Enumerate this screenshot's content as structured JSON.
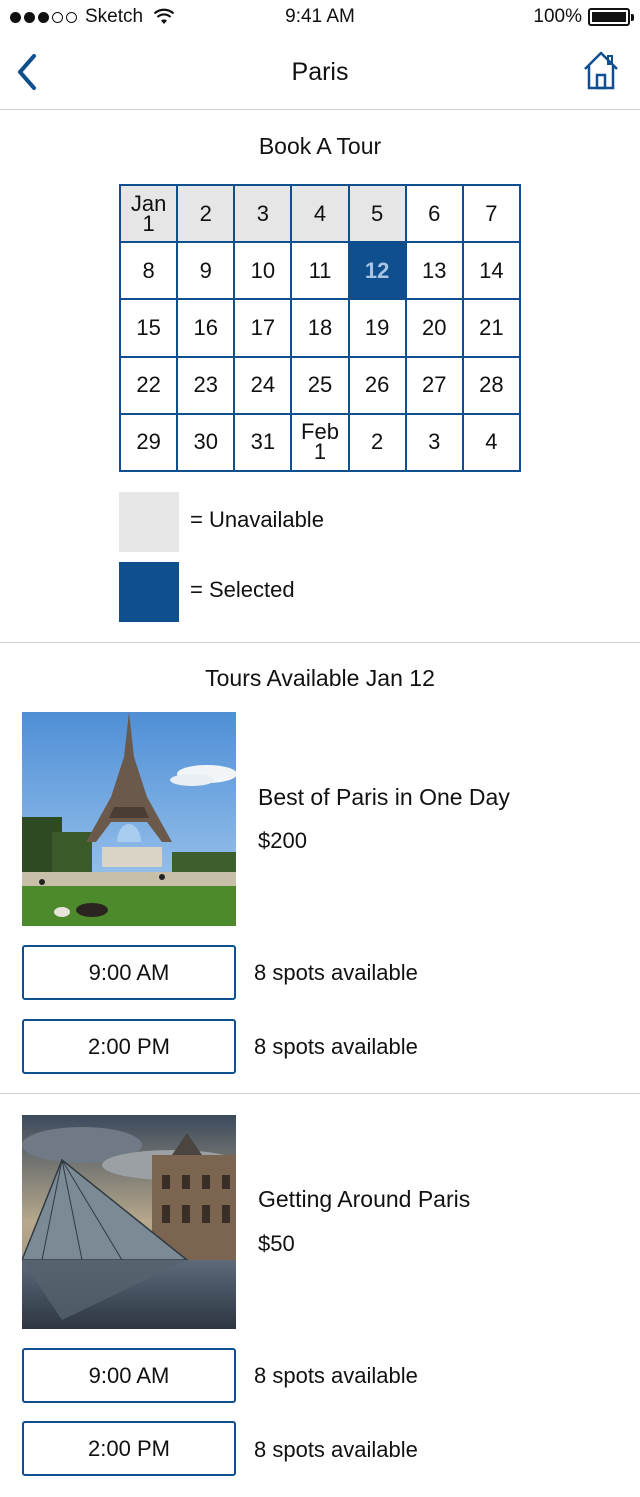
{
  "status_bar": {
    "carrier": "Sketch",
    "time": "9:41 AM",
    "battery": "100%"
  },
  "nav": {
    "title": "Paris",
    "back_icon": "chevron-left-icon",
    "home_icon": "home-icon"
  },
  "calendar": {
    "title": "Book A Tour",
    "rows": [
      [
        {
          "label": "Jan\n1",
          "state": "unavailable"
        },
        {
          "label": "2",
          "state": "unavailable"
        },
        {
          "label": "3",
          "state": "unavailable"
        },
        {
          "label": "4",
          "state": "unavailable"
        },
        {
          "label": "5",
          "state": "unavailable"
        },
        {
          "label": "6",
          "state": "available"
        },
        {
          "label": "7",
          "state": "available"
        }
      ],
      [
        {
          "label": "8",
          "state": "available"
        },
        {
          "label": "9",
          "state": "available"
        },
        {
          "label": "10",
          "state": "available"
        },
        {
          "label": "11",
          "state": "available"
        },
        {
          "label": "12",
          "state": "selected"
        },
        {
          "label": "13",
          "state": "available"
        },
        {
          "label": "14",
          "state": "available"
        }
      ],
      [
        {
          "label": "15",
          "state": "available"
        },
        {
          "label": "16",
          "state": "available"
        },
        {
          "label": "17",
          "state": "available"
        },
        {
          "label": "18",
          "state": "available"
        },
        {
          "label": "19",
          "state": "available"
        },
        {
          "label": "20",
          "state": "available"
        },
        {
          "label": "21",
          "state": "available"
        }
      ],
      [
        {
          "label": "22",
          "state": "available"
        },
        {
          "label": "23",
          "state": "available"
        },
        {
          "label": "24",
          "state": "available"
        },
        {
          "label": "25",
          "state": "available"
        },
        {
          "label": "26",
          "state": "available"
        },
        {
          "label": "27",
          "state": "available"
        },
        {
          "label": "28",
          "state": "available"
        }
      ],
      [
        {
          "label": "29",
          "state": "available"
        },
        {
          "label": "30",
          "state": "available"
        },
        {
          "label": "31",
          "state": "available"
        },
        {
          "label": "Feb\n1",
          "state": "available"
        },
        {
          "label": "2",
          "state": "available"
        },
        {
          "label": "3",
          "state": "available"
        },
        {
          "label": "4",
          "state": "available"
        }
      ]
    ]
  },
  "legend": {
    "unavailable_label": "= Unavailable",
    "selected_label": "= Selected"
  },
  "colors": {
    "brand_blue": "#0f4f8e",
    "unavailable_gray": "#e6e6e6",
    "divider": "#cfcfcf"
  },
  "tours_section": {
    "title": "Tours Available Jan 12"
  },
  "tours": [
    {
      "name": "Best of Paris in One Day",
      "price": "$200",
      "image": "eiffel-tower-photo",
      "slots": [
        {
          "time": "9:00 AM",
          "spots": "8 spots available"
        },
        {
          "time": "2:00 PM",
          "spots": "8 spots available"
        }
      ]
    },
    {
      "name": "Getting Around Paris",
      "price": "$50",
      "image": "louvre-pyramid-photo",
      "slots": [
        {
          "time": "9:00 AM",
          "spots": "8 spots available"
        },
        {
          "time": "2:00 PM",
          "spots": "8 spots available"
        }
      ]
    }
  ]
}
